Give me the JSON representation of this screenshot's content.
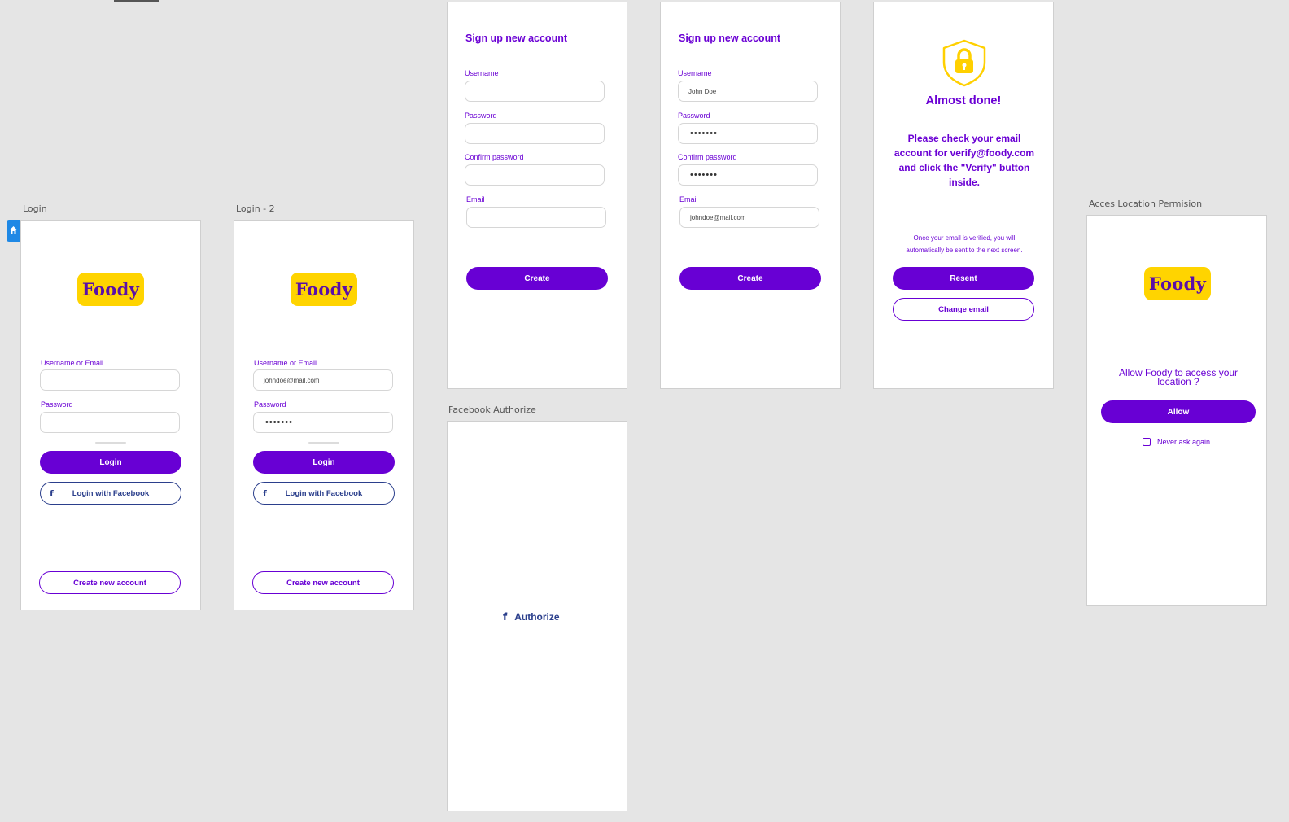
{
  "brand": {
    "logo_text": "Foody",
    "primary_color": "#6800d4",
    "logo_bg": "#ffd400",
    "fb_color": "#2b3f8c"
  },
  "login": {
    "artboard_label": "Login",
    "username_label": "Username or Email",
    "username_value": "",
    "password_label": "Password",
    "password_value": "",
    "login_button": "Login",
    "facebook_button": "Login with Facebook",
    "create_account_button": "Create new account"
  },
  "login2": {
    "artboard_label": "Login - 2",
    "username_label": "Username or Email",
    "username_value": "johndoe@mail.com",
    "password_label": "Password",
    "password_value": "•••••••",
    "login_button": "Login",
    "facebook_button": "Login with Facebook",
    "create_account_button": "Create new account"
  },
  "signup1": {
    "title": "Sign up new account",
    "username_label": "Username",
    "username_value": "",
    "password_label": "Password",
    "password_value": "",
    "confirm_label": "Confirm password",
    "confirm_value": "",
    "email_label": "Email",
    "email_value": "",
    "create_button": "Create"
  },
  "signup2": {
    "title": "Sign up new account",
    "username_label": "Username",
    "username_value": "John Doe",
    "password_label": "Password",
    "password_value": "•••••••",
    "confirm_label": "Confirm password",
    "confirm_value": "•••••••",
    "email_label": "Email",
    "email_value": "johndoe@mail.com",
    "create_button": "Create"
  },
  "verify": {
    "heading": "Almost done!",
    "message": "Please check your email account for verify@foody.com and click the \"Verify\" button inside.",
    "note": "Once your email is verified, you will automatically be sent to the next screen.",
    "resent_button": "Resent",
    "change_email_button": "Change email",
    "icon": "shield-lock-icon"
  },
  "facebook_authorize": {
    "artboard_label": "Facebook Authorize",
    "authorize_button": "Authorize"
  },
  "location": {
    "artboard_label": "Acces Location Permision",
    "question": "Allow Foody to access your location ?",
    "allow_button": "Allow",
    "never_ask_label": "Never ask again."
  }
}
